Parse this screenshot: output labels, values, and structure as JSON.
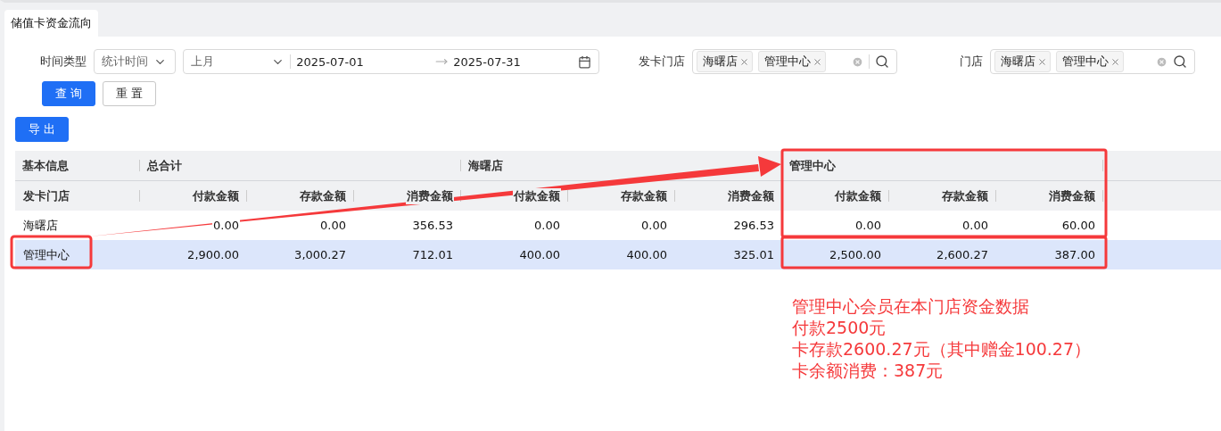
{
  "tabs": [
    {
      "label": "储值卡资金流向",
      "selected": true
    }
  ],
  "filters": {
    "time_type_label": "时间类型",
    "time_type": "统计时间",
    "period": "上月",
    "date_from": "2025-07-01",
    "date_to": "2025-07-31",
    "issuing_store_label": "发卡门店",
    "issuing_stores": [
      "海曙店",
      "管理中心"
    ],
    "store_label": "门店",
    "stores": [
      "海曙店",
      "管理中心"
    ]
  },
  "buttons": {
    "query": "查 询",
    "reset": "重 置",
    "export": "导 出"
  },
  "table": {
    "groups": [
      "基本信息",
      "总合计",
      "海曙店",
      "管理中心"
    ],
    "columns": [
      "发卡门店",
      "付款金额",
      "存款金额",
      "消费金额",
      "付款金额",
      "存款金额",
      "消费金额",
      "付款金额",
      "存款金额",
      "消费金额"
    ],
    "rows": [
      {
        "selected": false,
        "cells": [
          "海曙店",
          "0.00",
          "0.00",
          "356.53",
          "0.00",
          "0.00",
          "296.53",
          "0.00",
          "0.00",
          "60.00"
        ]
      },
      {
        "selected": true,
        "cells": [
          "管理中心",
          "2,900.00",
          "3,000.27",
          "712.01",
          "400.00",
          "400.00",
          "325.01",
          "2,500.00",
          "2,600.27",
          "387.00"
        ]
      }
    ]
  },
  "annotation": {
    "lines": [
      "管理中心会员在本门店资金数据",
      "付款2500元",
      "卡存款2600.27元（其中赠金100.27）",
      "卡余额消费：387元"
    ]
  }
}
